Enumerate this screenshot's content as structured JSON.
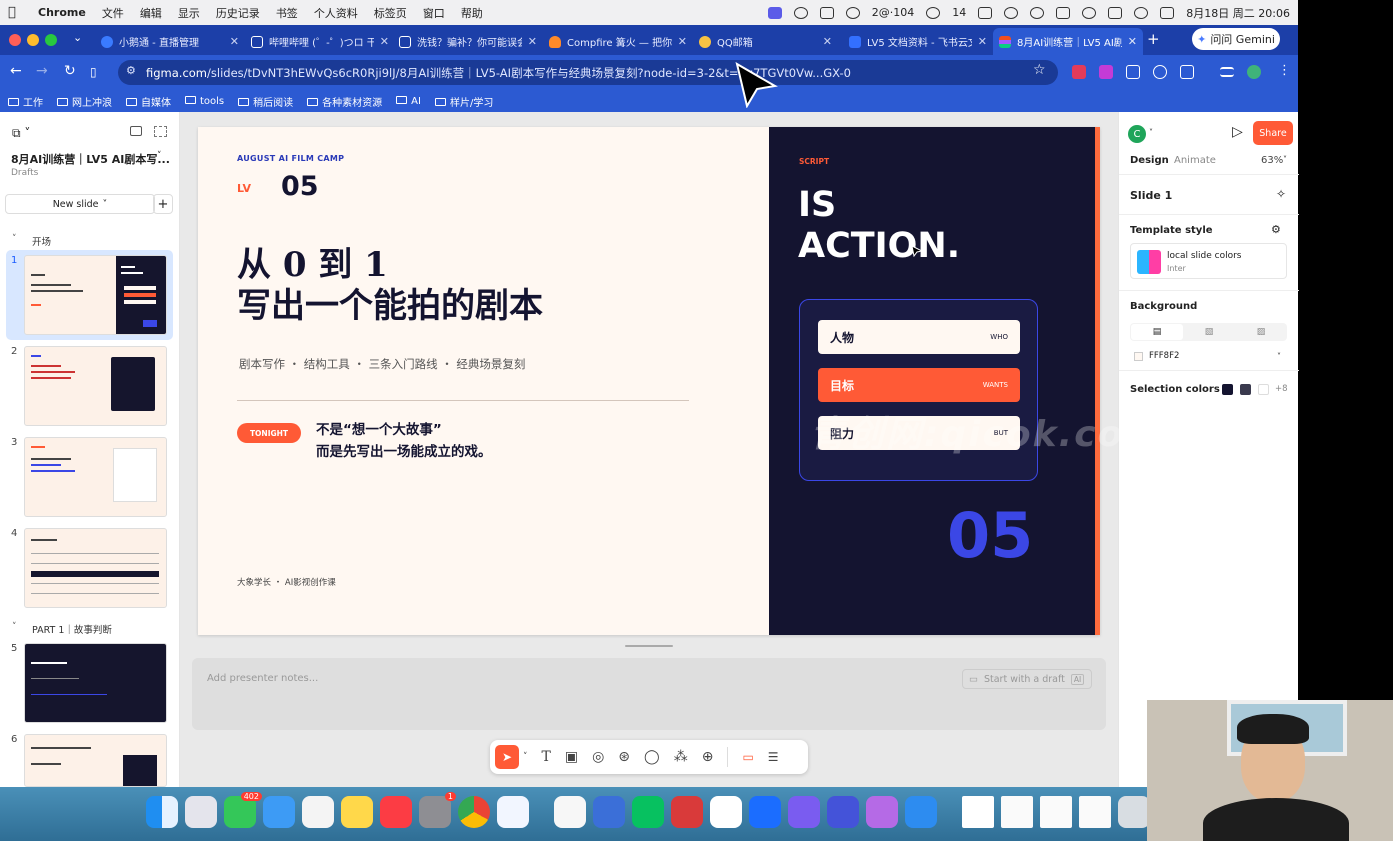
{
  "menubar": {
    "app": "Chrome",
    "items": [
      "文件",
      "编辑",
      "显示",
      "历史记录",
      "书签",
      "个人资料",
      "标签页",
      "窗口",
      "帮助"
    ],
    "status": {
      "battery_text": "2@·104",
      "wechat_count": "14",
      "datetime": "8月18日 周二 20:06"
    }
  },
  "tabs": [
    {
      "title": "小鹅通 - 直播管理",
      "favicon": "blue-circle-icon"
    },
    {
      "title": "哔哩哔哩 (゜-゜)つロ 干杯~",
      "favicon": "tv-icon"
    },
    {
      "title": "洗钱？骗补？你可能误会了",
      "favicon": "tv-icon"
    },
    {
      "title": "Compfire 篝火 — 把你的...",
      "favicon": "fire-icon"
    },
    {
      "title": "QQ邮箱",
      "favicon": "qq-icon"
    },
    {
      "title": "LV5 文档资料 - 飞书云文档",
      "favicon": "feishu-icon"
    },
    {
      "title": "8月AI训练营｜LV5 AI剧本...",
      "favicon": "figma-icon"
    }
  ],
  "gemini_label": "问问 Gemini",
  "url": {
    "host": "figma.com",
    "path": "/slides/tDvNT3hEWvQs6cR0Rji9lJ/8月AI训练营｜LV5-AI剧本写作与经典场景复刻?node-id=3-2&t=hu7TGVt0Vw...GX-0"
  },
  "bookmarks": [
    "工作",
    "网上冲浪",
    "自媒体",
    "tools",
    "稍后阅读",
    "各种素材资源",
    "AI",
    "样片/学习"
  ],
  "figma": {
    "file_title": "8月AI训练营｜LV5 AI剧本写...",
    "location": "Drafts",
    "new_slide": "New slide",
    "sections": [
      {
        "label": "开场"
      },
      {
        "label": "PART 1｜故事判断"
      }
    ],
    "slide_numbers": [
      "1",
      "2",
      "3",
      "4",
      "5",
      "6"
    ],
    "presenter_placeholder": "Add presenter notes...",
    "start_draft": "Start with a draft",
    "right": {
      "avatar": "C",
      "share": "Share",
      "tab_design": "Design",
      "tab_animate": "Animate",
      "zoom": "63%",
      "slide_name": "Slide 1",
      "template_style": "Template style",
      "template_name": "local slide colors",
      "template_font": "Inter",
      "background": "Background",
      "bg_hex": "FFF8F2",
      "selection_colors": "Selection colors",
      "more_colors": "+8"
    }
  },
  "slide": {
    "camp": "AUGUST AI FILM CAMP",
    "lv": "LV",
    "num": "05",
    "title_line1": "从 0 到 1",
    "title_line2": "写出一个能拍的剧本",
    "tags": "剧本写作 ・ 结构工具 ・ 三条入门路线 ・ 经典场景复刻",
    "tonight": "TONIGHT",
    "quote1": "不是“想一个大故事”",
    "quote2": "而是先写出一场能成立的戏。",
    "footer": "大象学长 ・ AI影视创作课",
    "script_label": "SCRIPT",
    "is": "IS",
    "action": "ACTION.",
    "cards": [
      {
        "cn": "人物",
        "en": "WHO"
      },
      {
        "cn": "目标",
        "en": "WANTS"
      },
      {
        "cn": "阻力",
        "en": "BUT"
      }
    ],
    "big_num": "05"
  },
  "watermark": "青创网:qicok.com",
  "dock": {
    "messages_badge": "402",
    "settings_badge": "1"
  },
  "colors": {
    "accent": "#ff5a36",
    "dark": "#141430",
    "blue": "#3b47e6",
    "cream": "#fff8f2",
    "chrome": "#2c5ad2"
  }
}
